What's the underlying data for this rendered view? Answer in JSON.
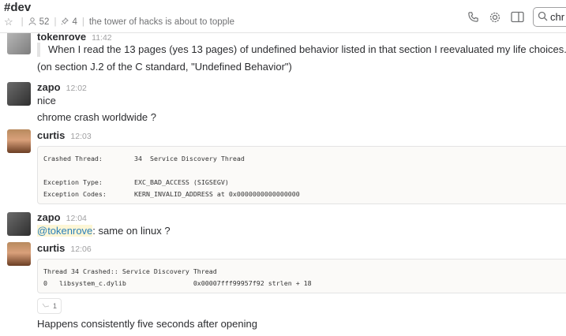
{
  "header": {
    "channel": "#dev",
    "members": "52",
    "pins": "4",
    "topic": "the tower of hacks is about to topple",
    "search_value": "chr"
  },
  "messages": [
    {
      "sender": "tokenrove",
      "time": "11:42",
      "quote": "When I read the 13 pages (yes 13 pages) of undefined behavior listed in that section I reevaluated my life choices.",
      "text": "(on section J.2 of the C standard, \"Undefined Behavior\")"
    },
    {
      "sender": "zapo",
      "time": "12:02",
      "lines": [
        "nice",
        "chrome crash worldwide ?"
      ]
    },
    {
      "sender": "curtis",
      "time": "12:03",
      "code": [
        [
          "Crashed Thread:",
          "34  Service Discovery Thread"
        ],
        [
          "",
          ""
        ],
        [
          "Exception Type:",
          "EXC_BAD_ACCESS (SIGSEGV)"
        ],
        [
          "Exception Codes:",
          "KERN_INVALID_ADDRESS at 0x0000000000000000"
        ]
      ]
    },
    {
      "sender": "zapo",
      "time": "12:04",
      "mention": "@tokenrove",
      "text": ": same on linux ?"
    },
    {
      "sender": "curtis",
      "time": "12:06",
      "code": [
        "Thread 34 Crashed:: Service Discovery Thread",
        "0   libsystem_c.dylib                 0x00007fff99957f92 strlen + 18"
      ],
      "reaction_count": "1",
      "text": "Happens consistently five seconds after opening"
    }
  ]
}
